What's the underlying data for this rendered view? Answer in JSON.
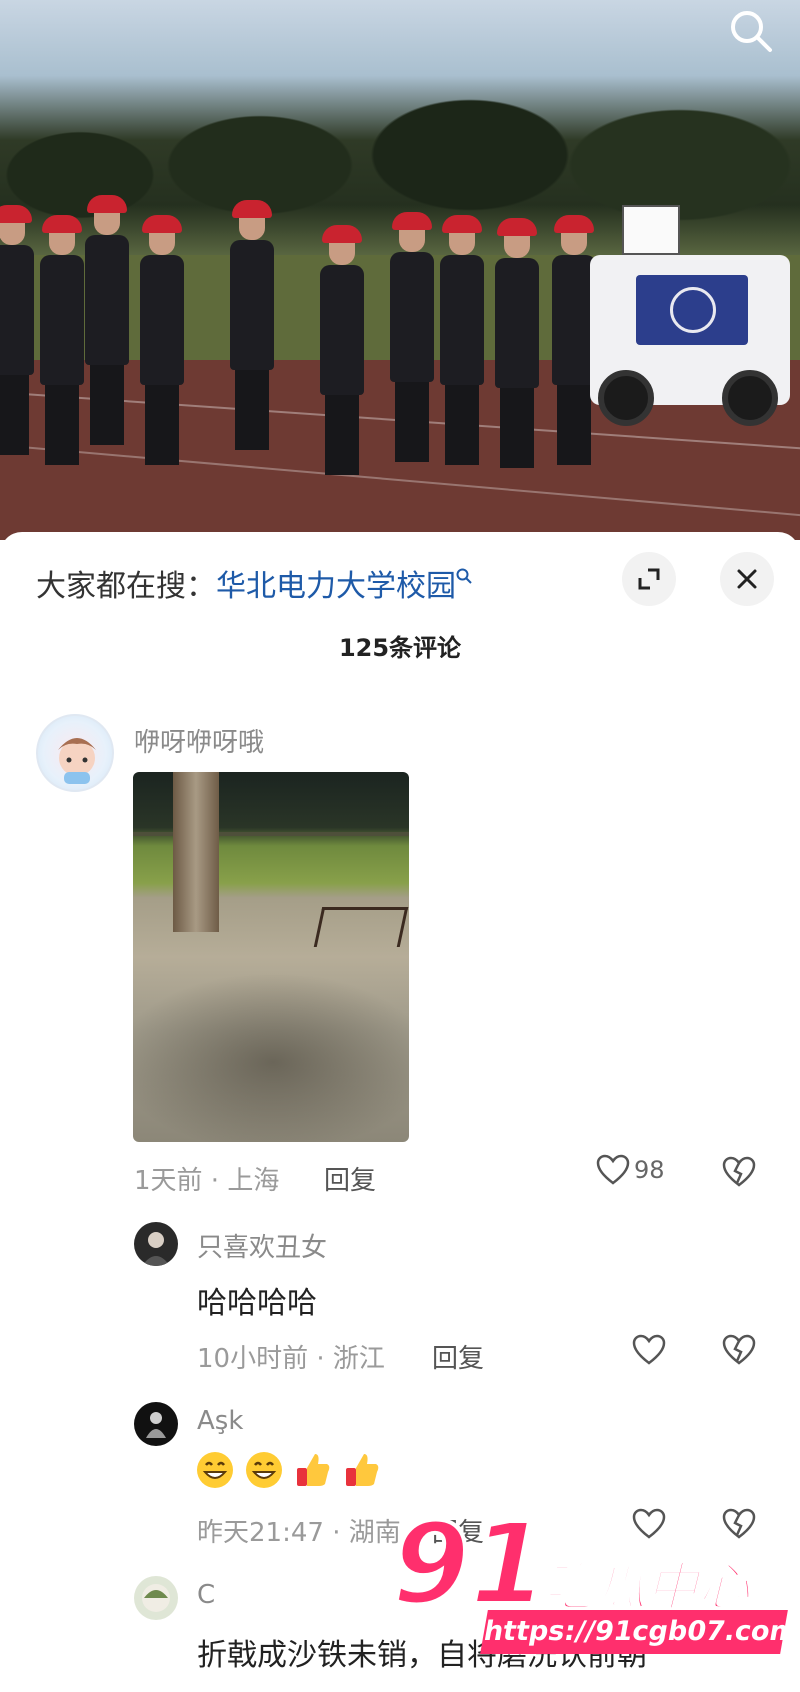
{
  "video": {
    "search_icon": "search-icon"
  },
  "panel": {
    "search_prefix": "大家都在搜：",
    "search_query": "华北电力大学校园",
    "expand_icon": "expand-icon",
    "close_icon": "close-icon",
    "comment_count": "125条评论"
  },
  "comments": [
    {
      "username": "咿呀咿呀哦",
      "meta": "1天前 · 上海",
      "reply": "回复",
      "likes": "98"
    },
    {
      "username": "只喜欢丑女",
      "text": "哈哈哈哈",
      "meta": "10小时前 · 浙江",
      "reply": "回复"
    },
    {
      "username": "Aşk",
      "emojis": [
        "grin-emoji",
        "grin-emoji",
        "thumbs-up-emoji",
        "thumbs-up-emoji"
      ],
      "meta": "昨天21:47 · 湖南",
      "reply": "回复"
    },
    {
      "username": "C",
      "text": "折戟成沙铁未销，自将磨洗认前朝"
    }
  ],
  "watermark": {
    "number": "91",
    "title": "吃瓜中心",
    "url": "https://91cgb07.com"
  },
  "colors": {
    "link_blue": "#1e5aa8",
    "watermark_pink": "#ff2f6d"
  }
}
